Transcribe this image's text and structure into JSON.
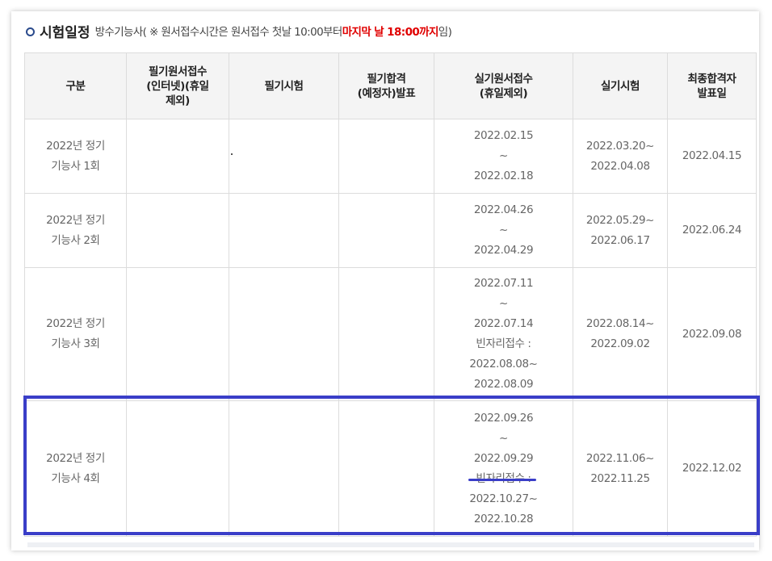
{
  "heading": {
    "title": "시험일정",
    "note_before": "방수기능사( ※ 원서접수시간은 원서접수 첫날 10:00부터 ",
    "note_red": "마지막 날 18:00까지",
    "note_after": "임)"
  },
  "columns": [
    "구분",
    "필기원서접수\n(인터넷)(휴일\n제외)",
    "필기시험",
    "필기합격\n(예정자)발표",
    "실기원서접수\n(휴일제외)",
    "실기시험",
    "최종합격자\n발표일"
  ],
  "rows": [
    {
      "session": "2022년 정기\n기능사 1회",
      "written_apply": "",
      "written_exam": "",
      "written_result": "",
      "practical_apply": "2022.02.15\n~\n2022.02.18",
      "practical_exam": "2022.03.20~\n2022.04.08",
      "final": "2022.04.15"
    },
    {
      "session": "2022년 정기\n기능사 2회",
      "written_apply": "",
      "written_exam": "",
      "written_result": "",
      "practical_apply": "2022.04.26\n~\n2022.04.29",
      "practical_exam": "2022.05.29~\n2022.06.17",
      "final": "2022.06.24"
    },
    {
      "session": "2022년 정기\n기능사 3회",
      "written_apply": "",
      "written_exam": "",
      "written_result": "",
      "practical_apply": "2022.07.11\n~\n2022.07.14\n빈자리접수 :\n2022.08.08~\n2022.08.09",
      "practical_exam": "2022.08.14~\n2022.09.02",
      "final": "2022.09.08"
    },
    {
      "session": "2022년 정기\n기능사 4회",
      "written_apply": "",
      "written_exam": "",
      "written_result": "",
      "practical_apply": "2022.09.26\n~\n2022.09.29\n빈자리접수 :\n2022.10.27~\n2022.10.28",
      "practical_exam": "2022.11.06~\n2022.11.25",
      "final": "2022.12.02"
    }
  ],
  "colors": {
    "highlight": "#3a3ec8",
    "header_bg": "#f4f4f4",
    "red": "#e00000"
  }
}
